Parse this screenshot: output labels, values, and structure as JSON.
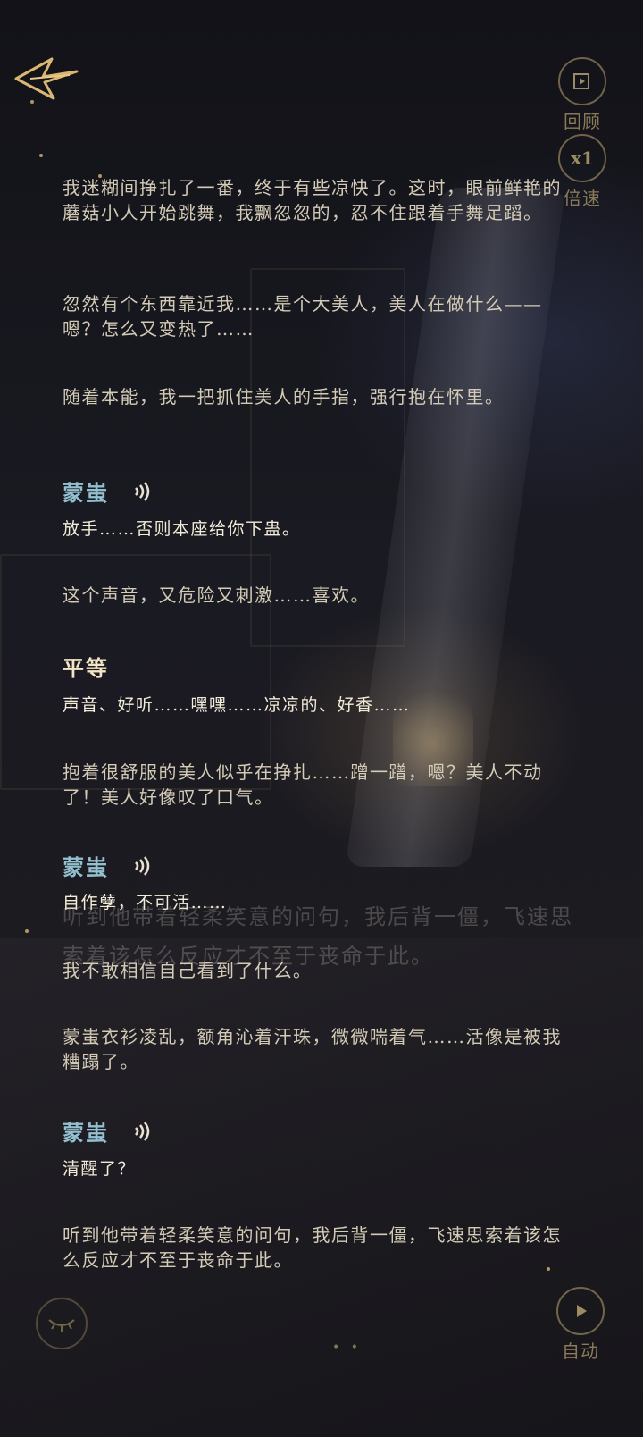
{
  "controls": {
    "review_label": "回顾",
    "speed_value": "x1",
    "speed_label": "倍速",
    "auto_label": "自动"
  },
  "story": {
    "p1": "我迷糊间挣扎了一番，终于有些凉快了。这时，眼前鲜艳的蘑菇小人开始跳舞，我飘忽忽的，忍不住跟着手舞足蹈。",
    "p2": "忽然有个东西靠近我……是个大美人，美人在做什么——嗯？怎么又变热了……",
    "p3": "随着本能，我一把抓住美人的手指，强行抱在怀里。",
    "speaker1": "蒙蚩",
    "line1": "放手……否则本座给你下蛊。",
    "p4": "这个声音，又危险又刺激……喜欢。",
    "speaker2": "平等",
    "line2": "声音、好听……嘿嘿……凉凉的、好香……",
    "p5": "抱着很舒服的美人似乎在挣扎……蹭一蹭，嗯？美人不动了！美人好像叹了口气。",
    "speaker3": "蒙蚩",
    "line3": "自作孽，不可活……",
    "ghost": "听到他带着轻柔笑意的问句，我后背一僵，飞速思索着该怎么反应才不至于丧命于此。",
    "p6": "我不敢相信自己看到了什么。",
    "p7": "蒙蚩衣衫凌乱，额角沁着汗珠，微微喘着气……活像是被我糟蹋了。",
    "speaker4": "蒙蚩",
    "line4": "清醒了？",
    "p8": "听到他带着轻柔笑意的问句，我后背一僵，飞速思索着该怎么反应才不至于丧命于此。"
  }
}
